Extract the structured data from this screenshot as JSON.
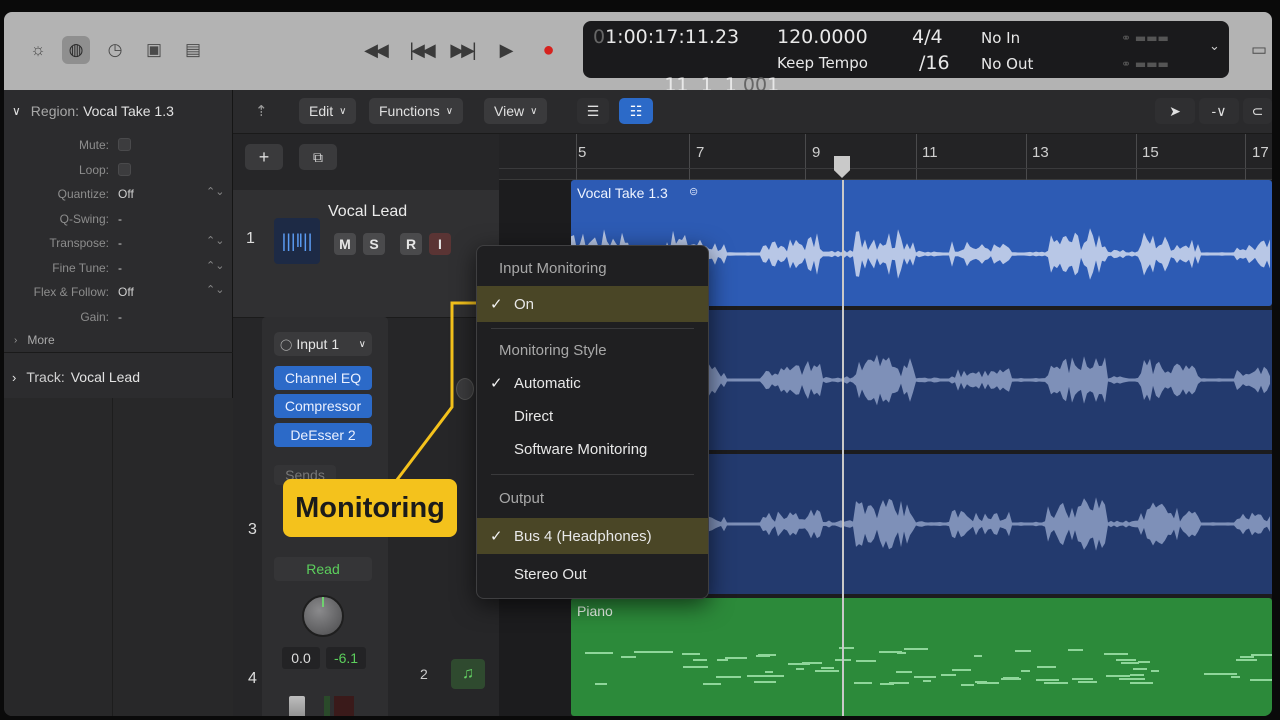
{
  "topbar": {
    "icons": [
      "activity-icon",
      "tuner-icon",
      "clock-icon",
      "mixer-icon",
      "editors-icon"
    ],
    "transport": {
      "rewind": "◀◀",
      "back": "|◀◀",
      "forward": "▶▶|",
      "play": "▶",
      "record": "●"
    }
  },
  "lcd": {
    "time_dim": "0",
    "time": "1:00:17:11.23",
    "bars": "11  1  1",
    "ticks_dim": "00",
    "ticks": "1",
    "tempo": "120.0000",
    "tempo_mode": "Keep Tempo",
    "sig_top": "4/4",
    "sig_bottom": "/16",
    "midi_in": "No In",
    "midi_out": "No Out"
  },
  "inspector": {
    "region_title": "Region:",
    "region_name": "Vocal Take 1.3",
    "rows": [
      {
        "label": "Mute:",
        "value": "",
        "type": "checkbox"
      },
      {
        "label": "Loop:",
        "value": "",
        "type": "checkbox"
      },
      {
        "label": "Quantize:",
        "value": "Off",
        "type": "stepper"
      },
      {
        "label": "Q-Swing:",
        "value": "-",
        "type": "plain"
      },
      {
        "label": "Transpose:",
        "value": "-",
        "type": "stepper"
      },
      {
        "label": "Fine Tune:",
        "value": "-",
        "type": "stepper"
      },
      {
        "label": "Flex & Follow:",
        "value": "Off",
        "type": "stepper"
      },
      {
        "label": "Gain:",
        "value": "-",
        "type": "plain"
      }
    ],
    "more_label": "More",
    "track_title": "Track:",
    "track_name": "Vocal Lead"
  },
  "toolbar": {
    "edit": "Edit",
    "functions": "Functions",
    "view": "View"
  },
  "ruler": {
    "bars": [
      "5",
      "7",
      "9",
      "11",
      "13",
      "15",
      "17"
    ]
  },
  "tracks": [
    {
      "number": "1",
      "name": "Vocal Lead",
      "buttons": [
        "M",
        "S",
        "R",
        "I"
      ]
    },
    {
      "number": "3"
    },
    {
      "number": "4"
    }
  ],
  "channel": {
    "input": "Input 1",
    "plugins": [
      "Channel EQ",
      "Compressor",
      "DeEsser 2"
    ],
    "sends": "Sends",
    "automation": "Read",
    "pan_value": "0.0",
    "level_value": "-6.1",
    "track_index": "2"
  },
  "regions": [
    {
      "name": "Vocal Take 1.3",
      "color": "#2d5bb4"
    },
    {
      "name": "Piano",
      "color": "#2c8a3a"
    }
  ],
  "popup": {
    "header_input": "Input Monitoring",
    "on": "On",
    "header_style": "Monitoring Style",
    "automatic": "Automatic",
    "direct": "Direct",
    "software": "Software Monitoring",
    "header_output": "Output",
    "bus4": "Bus 4 (Headphones)",
    "stereo_out": "Stereo Out",
    "check": "✓"
  },
  "callout": {
    "label": "Monitoring",
    "color": "#f4c21c"
  }
}
